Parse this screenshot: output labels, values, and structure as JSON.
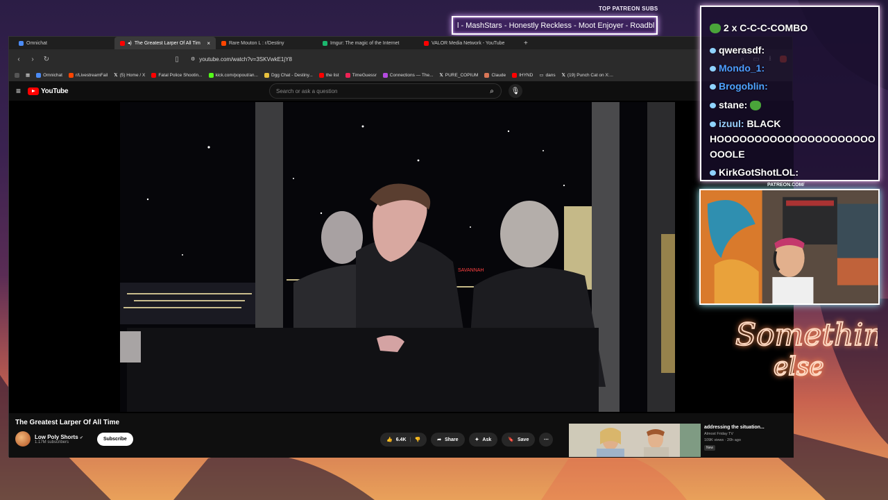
{
  "overlay": {
    "patreon_subs_label": "TOP PATREON SUBS",
    "ticker_text": "l - MashStars - Honestly Reckless - Moot Enjoyer - Roadbl",
    "patreon_url": "PATREON.COM/",
    "neon_sign_line1": "Something",
    "neon_sign_line2": "else"
  },
  "chat": {
    "messages": [
      {
        "user": "qwerasdf:",
        "text": ""
      },
      {
        "user": "Mondo_1:",
        "text": ""
      },
      {
        "user": "Brogoblin:",
        "text": ""
      },
      {
        "user": "stane:",
        "text": ""
      },
      {
        "user": "izuul:",
        "text": "BLACK"
      },
      {
        "user": "",
        "text": "HOOOOOOOOOOOOOOOOOOOOO"
      },
      {
        "user": "",
        "text": "OOOLE"
      },
      {
        "user": "KirkGotShotLOL:",
        "text": ""
      }
    ],
    "combo_text": "2 x C-C-C-COMBO"
  },
  "browser": {
    "tabs": [
      {
        "label": "Omnichat",
        "color": "#4b8bf5"
      },
      {
        "label": "The Greatest Larper Of All Tim",
        "color": "#ff0000"
      },
      {
        "label": "Rare Mouton L : r/Destiny",
        "color": "#ff4500"
      },
      {
        "label": "Imgur: The magic of the Internet",
        "color": "#1bb76e"
      },
      {
        "label": "VALOR Media Network - YouTube",
        "color": "#ff0000"
      }
    ],
    "url": "youtube.com/watch?v=3SKVwkE1jY8",
    "bookmarks": [
      "Omnichat",
      "r/LivestreamFail",
      "(5) Home / X",
      "Fatal Police Shootin...",
      "kick.com/popout/an...",
      "Dgg Chat - Destiny...",
      "the list",
      "TimeGuessr",
      "Connections — The...",
      "PURE_COPIUM",
      "Claude",
      "IHYND",
      "dans",
      "(19) Punch Cat on X:..."
    ]
  },
  "youtube": {
    "logo_text": "YouTube",
    "search_placeholder": "Search or ask a question",
    "video_title": "The Greatest Larper Of All Time",
    "channel_name": "Low Poly Shorts",
    "channel_subs": "1.17M subscribers",
    "subscribe_label": "Subscribe",
    "like_count": "6.4K",
    "share_label": "Share",
    "ask_label": "Ask",
    "save_label": "Save",
    "scene_sign": "SAVANNAH",
    "recommended": {
      "title": "addressing the situation...",
      "channel": "Almost Friday TV",
      "stats": "109K views · 20h ago",
      "badge": "New"
    }
  }
}
